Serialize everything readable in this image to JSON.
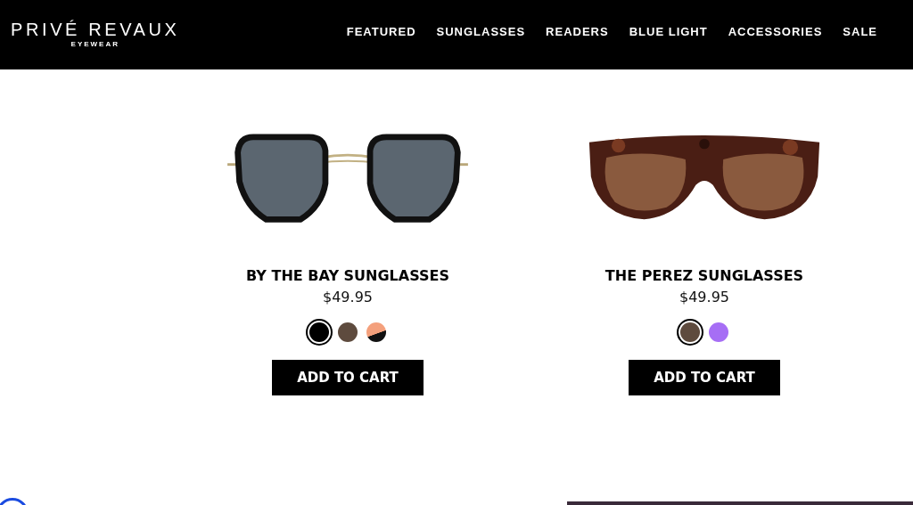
{
  "brand": {
    "name": "PRIVÉ REVAUX",
    "tagline": "EYEWEAR"
  },
  "nav": [
    {
      "label": "FEATURED"
    },
    {
      "label": "SUNGLASSES"
    },
    {
      "label": "READERS"
    },
    {
      "label": "BLUE LIGHT"
    },
    {
      "label": "ACCESSORIES"
    },
    {
      "label": "SALE"
    }
  ],
  "products": [
    {
      "kind": "square",
      "name": "BY THE BAY SUNGLASSES",
      "price": "$49.95",
      "button": "ADD TO CART",
      "swatches": [
        {
          "color": "#000000",
          "selected": true,
          "kind": "solid"
        },
        {
          "color": "#5e4b3e",
          "selected": false,
          "kind": "solid"
        },
        {
          "color": "#f4a07c",
          "selected": false,
          "kind": "split"
        }
      ]
    },
    {
      "kind": "cat-eye",
      "name": "THE PEREZ SUNGLASSES",
      "price": "$49.95",
      "button": "ADD TO CART",
      "swatches": [
        {
          "color": "#5e4b3e",
          "selected": true,
          "kind": "solid"
        },
        {
          "color": "#a66ef5",
          "selected": false,
          "kind": "solid"
        }
      ]
    }
  ]
}
